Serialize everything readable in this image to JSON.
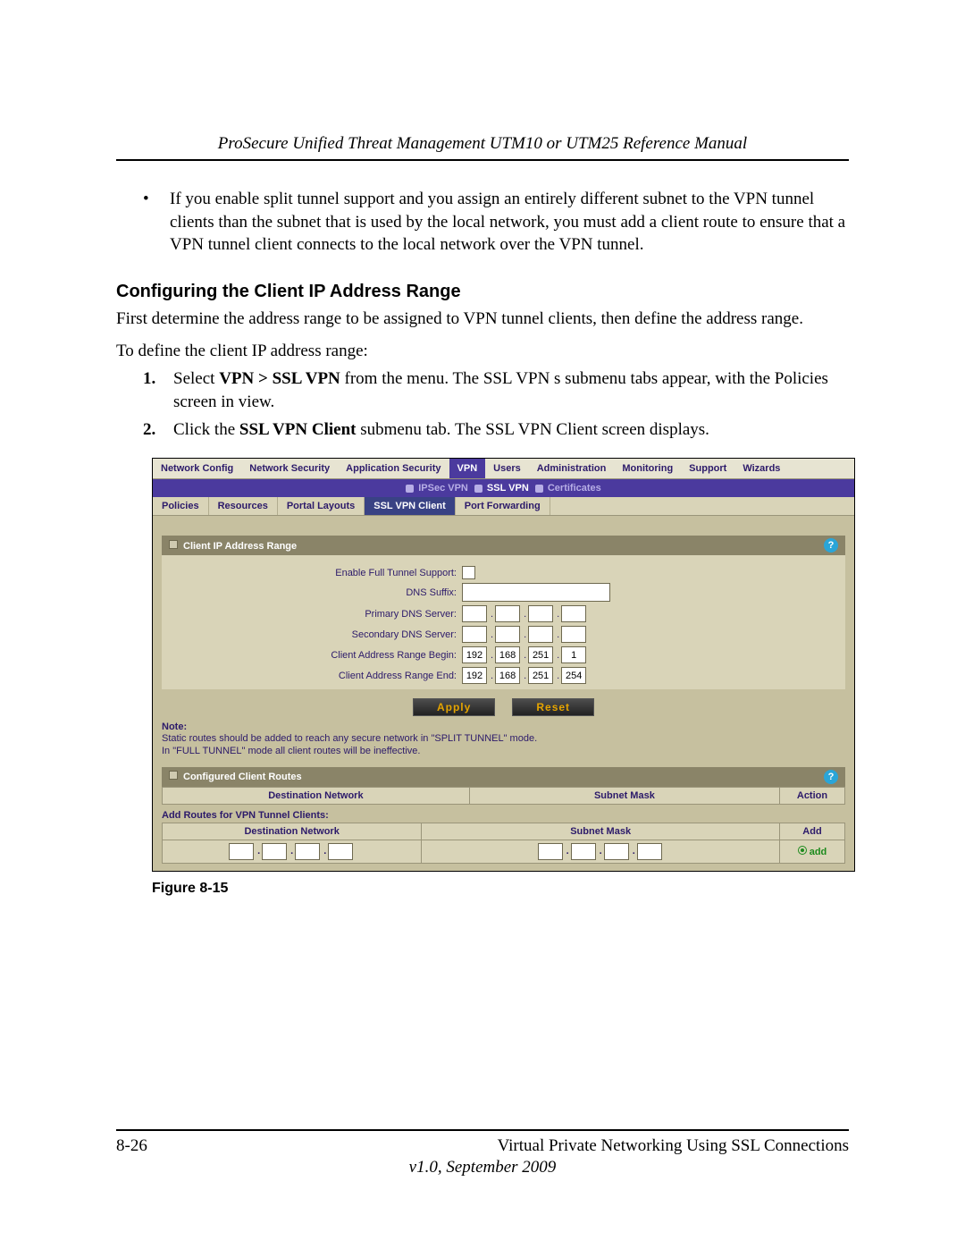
{
  "header": "ProSecure Unified Threat Management UTM10 or UTM25 Reference Manual",
  "bullet": "If you enable split tunnel support and you assign an entirely different subnet to the VPN tunnel clients than the subnet that is used by the local network, you must add a client route to ensure that a VPN tunnel client connects to the local network over the VPN tunnel.",
  "section_heading": "Configuring the Client IP Address Range",
  "para1": "First determine the address range to be assigned to VPN tunnel clients, then define the address range.",
  "para2": "To define the client IP address range:",
  "steps": {
    "s1_a": "Select ",
    "s1_b": "VPN > SSL VPN",
    "s1_c": " from the menu. The SSL VPN s submenu tabs appear, with the Policies screen in view.",
    "s2_a": "Click the ",
    "s2_b": "SSL VPN Client",
    "s2_c": " submenu tab. The SSL VPN Client screen displays."
  },
  "fig_caption": "Figure 8-15",
  "footer": {
    "left": "8-26",
    "right": "Virtual Private Networking Using SSL Connections",
    "version": "v1.0, September 2009"
  },
  "ui": {
    "topnav": [
      "Network Config",
      "Network Security",
      "Application Security",
      "VPN",
      "Users",
      "Administration",
      "Monitoring",
      "Support",
      "Wizards"
    ],
    "submenus": [
      "IPSec VPN",
      "SSL VPN",
      "Certificates"
    ],
    "subtabs": [
      "Policies",
      "Resources",
      "Portal Layouts",
      "SSL VPN Client",
      "Port Forwarding"
    ],
    "sect1": "Client IP Address Range",
    "labels": {
      "fulltunnel": "Enable Full Tunnel Support:",
      "dnssuffix": "DNS Suffix:",
      "pdns": "Primary DNS Server:",
      "sdns": "Secondary DNS Server:",
      "begin": "Client Address Range Begin:",
      "end": "Client Address Range End:"
    },
    "begin": [
      "192",
      "168",
      "251",
      "1"
    ],
    "end": [
      "192",
      "168",
      "251",
      "254"
    ],
    "apply": "Apply",
    "reset": "Reset",
    "note_title": "Note:",
    "note1": "Static routes should be added to reach any secure network in \"SPLIT TUNNEL\" mode.",
    "note2": "In \"FULL TUNNEL\" mode all client routes will be ineffective.",
    "sect2": "Configured Client Routes",
    "cols": {
      "dest": "Destination Network",
      "mask": "Subnet Mask",
      "action": "Action",
      "add": "Add"
    },
    "addhdr": "Add Routes for VPN Tunnel Clients:",
    "addbtn": "add"
  }
}
